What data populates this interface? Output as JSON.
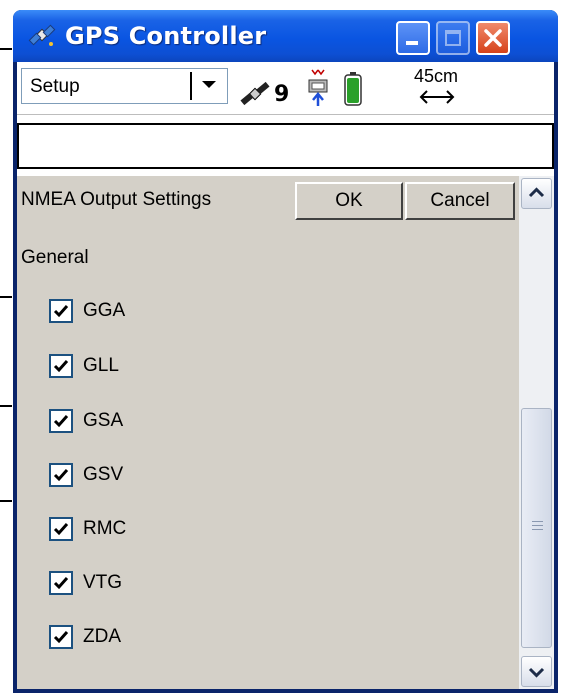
{
  "window": {
    "title": "GPS Controller",
    "icon": "satellite-app-icon"
  },
  "titlebar_buttons": [
    "minimize",
    "maximize",
    "close"
  ],
  "toolbar": {
    "mode": "Setup",
    "satellite_count": "9",
    "accuracy": "45cm"
  },
  "status_text": "",
  "header": {
    "title": "NMEA Output Settings",
    "ok_label": "OK",
    "cancel_label": "Cancel"
  },
  "settings": {
    "section_label": "General",
    "items": [
      {
        "label": "GGA",
        "checked": true
      },
      {
        "label": "GLL",
        "checked": true
      },
      {
        "label": "GSA",
        "checked": true
      },
      {
        "label": "GSV",
        "checked": true
      },
      {
        "label": "RMC",
        "checked": true
      },
      {
        "label": "VTG",
        "checked": true
      },
      {
        "label": "ZDA",
        "checked": true
      }
    ]
  },
  "colors": {
    "titlebar": "#0a55e2",
    "panel": "#d4d0c8",
    "battery": "#2aa02a"
  }
}
